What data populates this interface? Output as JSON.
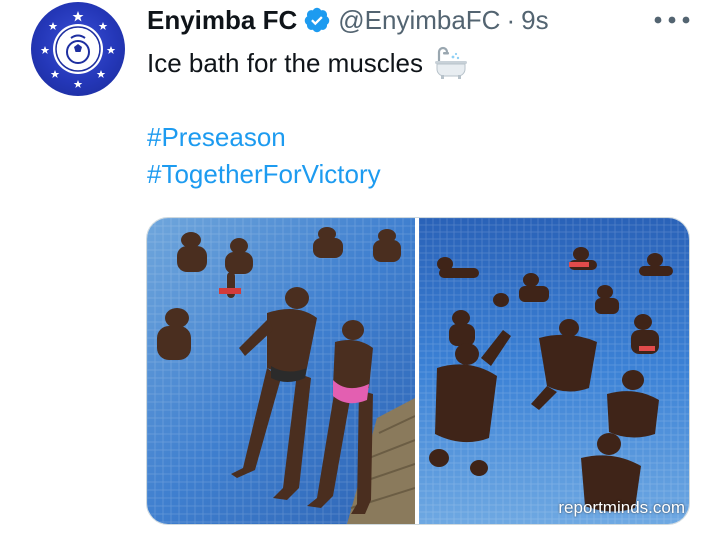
{
  "account": {
    "display_name": "Enyimba FC",
    "handle": "@EnyimbaFC",
    "separator": "·",
    "timestamp": "9s",
    "verified": true,
    "avatar_icon": "enyimba-football-club-crest"
  },
  "tweet": {
    "text": "Ice bath for the muscles",
    "emoji_icon": "bathtub-icon",
    "hashtags": [
      "#Preseason",
      "#TogetherForVictory"
    ]
  },
  "media": {
    "photos": [
      {
        "description_icon": "players-in-pool-photo"
      },
      {
        "description_icon": "players-in-pool-photo"
      }
    ],
    "watermark": "reportminds.com"
  },
  "colors": {
    "link": "#1d9bf0",
    "text": "#0f1419",
    "secondary": "#536471",
    "verified": "#1d9bf0",
    "pool": "#2f6fc4"
  }
}
